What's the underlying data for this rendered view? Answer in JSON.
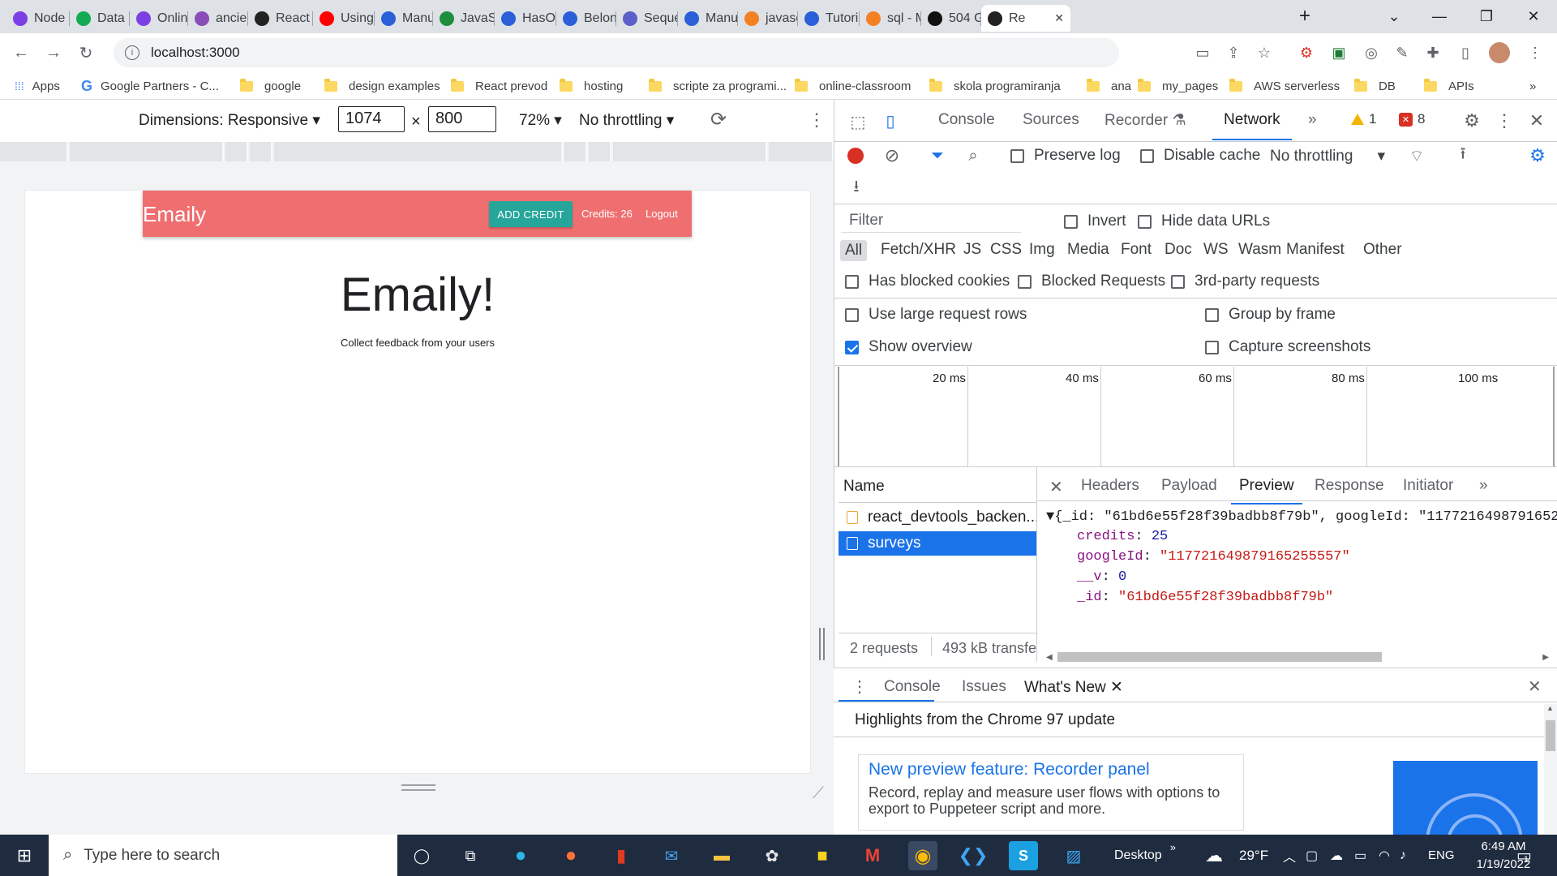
{
  "browser": {
    "tabs": [
      {
        "label": "Node",
        "color": "#7b3fe4"
      },
      {
        "label": "Data |",
        "color": "#13aa52"
      },
      {
        "label": "Online",
        "color": "#7b3fe4"
      },
      {
        "label": "ancien",
        "color": "#8a4db8"
      },
      {
        "label": "React",
        "color": "#222"
      },
      {
        "label": "Using",
        "color": "#ff0000"
      },
      {
        "label": "Manu",
        "color": "#2b5fd9"
      },
      {
        "label": "JavaSc",
        "color": "#1e8e3e"
      },
      {
        "label": "HasOr",
        "color": "#2b5fd9"
      },
      {
        "label": "Belong",
        "color": "#2b5fd9"
      },
      {
        "label": "Seque",
        "color": "#5b5fc7"
      },
      {
        "label": "Manu",
        "color": "#2b5fd9"
      },
      {
        "label": "javasc",
        "color": "#f48024"
      },
      {
        "label": "Tutori",
        "color": "#2b5fd9"
      },
      {
        "label": "sql - M",
        "color": "#f48024"
      },
      {
        "label": "504 G",
        "color": "#111"
      },
      {
        "label": "Re",
        "color": "#222"
      }
    ],
    "address": "localhost:3000",
    "bookmarks": [
      "Apps",
      "Google Partners - C...",
      "google",
      "design examples",
      "React prevod",
      "hosting",
      "scripte za programi...",
      "online-classroom",
      "skola programiranja",
      "ana",
      "my_pages",
      "AWS serverless",
      "DB",
      "APIs"
    ]
  },
  "device_toolbar": {
    "dimensions_label": "Dimensions: Responsive",
    "width": "1074",
    "height": "800",
    "times": "×",
    "zoom": "72%",
    "throttling": "No throttling"
  },
  "app": {
    "brand": "Emaily",
    "add_credit": "ADD CREDIT",
    "credits": "Credits: 26",
    "logout": "Logout",
    "hero_title": "Emaily!",
    "hero_subtitle": "Collect feedback from your users"
  },
  "devtools": {
    "tabs": [
      "Console",
      "Sources",
      "Recorder",
      "Network"
    ],
    "warnings": "1",
    "errors": "8",
    "network_toolbar": {
      "preserve_log": "Preserve log",
      "disable_cache": "Disable cache",
      "throttling": "No throttling"
    },
    "filter_placeholder": "Filter",
    "invert": "Invert",
    "hide_data_urls": "Hide data URLs",
    "types": [
      "All",
      "Fetch/XHR",
      "JS",
      "CSS",
      "Img",
      "Media",
      "Font",
      "Doc",
      "WS",
      "Wasm",
      "Manifest",
      "Other"
    ],
    "has_blocked_cookies": "Has blocked cookies",
    "blocked_requests": "Blocked Requests",
    "third_party": "3rd-party requests",
    "large_rows": "Use large request rows",
    "group_by_frame": "Group by frame",
    "show_overview": "Show overview",
    "capture_screenshots": "Capture screenshots",
    "timeline_ticks": [
      "20 ms",
      "40 ms",
      "60 ms",
      "80 ms",
      "100 ms"
    ],
    "name_header": "Name",
    "requests": [
      "react_devtools_backen...",
      "surveys"
    ],
    "status": {
      "requests": "2 requests",
      "transferred": "493 kB transfe"
    },
    "detail_tabs": [
      "Headers",
      "Payload",
      "Preview",
      "Response",
      "Initiator"
    ],
    "preview": {
      "summary": "{_id: \"61bd6e55f28f39badbb8f79b\", googleId: \"1177216498791652",
      "credits_key": "credits",
      "credits_val": "25",
      "googleId_key": "googleId",
      "googleId_val": "\"117721649879165255557\"",
      "v_key": "__v",
      "v_val": "0",
      "id_key": "_id",
      "id_val": "\"61bd6e55f28f39badbb8f79b\""
    },
    "drawer": {
      "tabs": [
        "Console",
        "Issues",
        "What's New"
      ],
      "highlight": "Highlights from the Chrome 97 update",
      "card_title": "New preview feature: Recorder panel",
      "card_text": "Record, replay and measure user flows with options to export to Puppeteer script and more."
    }
  },
  "taskbar": {
    "search_placeholder": "Type here to search",
    "desktop_label": "Desktop",
    "temperature": "29°F",
    "lang": "ENG",
    "time": "6:49 AM",
    "date": "1/19/2022",
    "notifications": "1"
  }
}
